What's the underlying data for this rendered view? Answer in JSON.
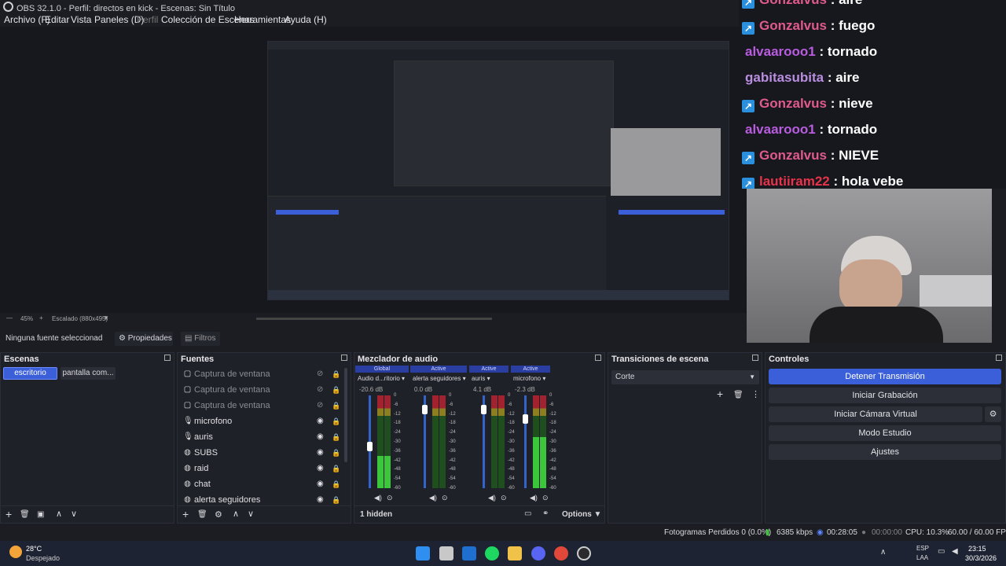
{
  "window": {
    "title": "OBS 32.1.0 - Perfil: directos en kick - Escenas: Sin Título"
  },
  "menu": [
    "Archivo (F)",
    "Editar",
    "Vista",
    "Paneles (D)",
    "Perfil",
    "Colección de Escenas",
    "Herramientas",
    "Ayuda (H)"
  ],
  "preview": {
    "zoom": "45%",
    "scale_label": "Escalado (880x495)"
  },
  "properties": {
    "no_source": "Ninguna fuente seleccionad",
    "props_btn": "Propiedades",
    "filters_btn": "Filtros"
  },
  "chat": [
    {
      "user": "Gonzalvus",
      "msg": ": aire",
      "color": "#e15a8c",
      "badge": true
    },
    {
      "user": "Gonzalvus",
      "msg": ": fuego",
      "color": "#e15a8c",
      "badge": true
    },
    {
      "user": "alvaarooo1",
      "msg": ": tornado",
      "color": "#b95ce0",
      "badge": false
    },
    {
      "user": "gabitasubita",
      "msg": ": aire",
      "color": "#b98de0",
      "badge": false
    },
    {
      "user": "Gonzalvus",
      "msg": ": nieve",
      "color": "#e15a8c",
      "badge": true
    },
    {
      "user": "alvaarooo1",
      "msg": ": tornado",
      "color": "#b95ce0",
      "badge": false
    },
    {
      "user": "Gonzalvus",
      "msg": ": NIEVE",
      "color": "#e15a8c",
      "badge": true
    },
    {
      "user": "lautiiram22",
      "msg": ": hola vebe",
      "color": "#e8334a",
      "badge": true
    }
  ],
  "scenes": {
    "title": "Escenas",
    "items": [
      "escritorio",
      "pantalla com..."
    ],
    "active": 0
  },
  "sources": {
    "title": "Fuentes",
    "items": [
      {
        "name": "Captura de ventana",
        "icon": "window-icon",
        "hidden": true
      },
      {
        "name": "Captura de ventana",
        "icon": "window-icon",
        "hidden": true
      },
      {
        "name": "Captura de ventana",
        "icon": "window-icon",
        "hidden": true
      },
      {
        "name": "microfono",
        "icon": "mic-icon",
        "hidden": false
      },
      {
        "name": "auris",
        "icon": "mic-icon",
        "hidden": false
      },
      {
        "name": "SUBS",
        "icon": "globe-icon",
        "hidden": false
      },
      {
        "name": "raid",
        "icon": "globe-icon",
        "hidden": false
      },
      {
        "name": "chat",
        "icon": "globe-icon",
        "hidden": false
      },
      {
        "name": "alerta seguidores",
        "icon": "globe-icon",
        "hidden": false
      }
    ]
  },
  "mixer": {
    "title": "Mezclador de audio",
    "channels": [
      {
        "status": "Global",
        "name": "Audio d...ritorio",
        "db": "-20.6 dB",
        "level": 0.35,
        "fader": 0.5
      },
      {
        "status": "Active",
        "name": "alerta seguidores",
        "db": "0.0 dB",
        "level": 0.0,
        "fader": 0.9
      },
      {
        "status": "Active",
        "name": "auris",
        "db": "4.1 dB",
        "level": 0.0,
        "fader": 0.9
      },
      {
        "status": "Active",
        "name": "microfono",
        "db": "-2.3 dB",
        "level": 0.55,
        "fader": 0.8
      }
    ],
    "scale": [
      "0",
      "-6",
      "-12",
      "-18",
      "-24",
      "-30",
      "-36",
      "-42",
      "-48",
      "-54",
      "-60"
    ],
    "hidden_label": "1 hidden",
    "options_label": "Options"
  },
  "transitions": {
    "title": "Transiciones de escena",
    "selected": "Corte"
  },
  "controls": {
    "title": "Controles",
    "buttons": [
      "Detener Transmisión",
      "Iniciar Grabación",
      "Iniciar Cámara Virtual",
      "Modo Estudio",
      "Ajustes"
    ]
  },
  "status": {
    "dropped": "Fotogramas Perdidos 0 (0.0%)",
    "kbps": "6385 kbps",
    "stream_time": "00:28:05",
    "rec_time": "00:00:00",
    "cpu": "CPU: 10.3%",
    "fps": "60.00 / 60.00 FPS"
  },
  "taskbar": {
    "temp": "28°C",
    "weather": "Despejado",
    "lang1": "ESP",
    "lang2": "LAA",
    "time": "23:15",
    "date": "30/3/2026"
  },
  "colors": {
    "accent": "#3a5fd9",
    "meter_green": "#3cc63c",
    "meter_blue": "#3463c9",
    "meter_red": "#a2232f"
  }
}
